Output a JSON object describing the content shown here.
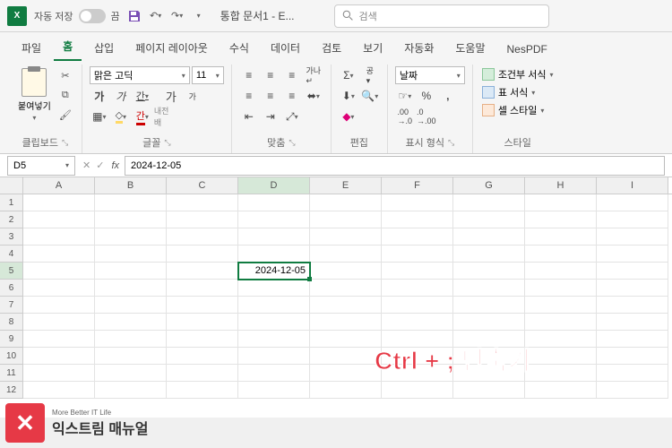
{
  "titlebar": {
    "autosave_label": "자동 저장",
    "autosave_state": "끔",
    "doc_title": "통합 문서1 - E..."
  },
  "search": {
    "placeholder": "검색"
  },
  "tabs": [
    "파일",
    "홈",
    "삽입",
    "페이지 레이아웃",
    "수식",
    "데이터",
    "검토",
    "보기",
    "자동화",
    "도움말",
    "NesPDF"
  ],
  "active_tab_index": 1,
  "ribbon": {
    "clipboard": {
      "label": "클립보드",
      "paste": "붙여넣기"
    },
    "font": {
      "label": "글꼴",
      "name": "맑은 고딕",
      "size": "11",
      "bold": "가",
      "italic": "가",
      "underline": "간",
      "grow": "가",
      "shrink": "가",
      "hanja": "내전 배"
    },
    "align": {
      "label": "맞춤"
    },
    "edit": {
      "label": "편집"
    },
    "number": {
      "label": "표시 형식",
      "format": "날짜"
    },
    "styles": {
      "label": "스타일",
      "cond": "조건부 서식",
      "table": "표 서식",
      "cell": "셀 스타일"
    }
  },
  "namebox": {
    "ref": "D5"
  },
  "formula": {
    "value": "2024-12-05"
  },
  "grid": {
    "cols": [
      "A",
      "B",
      "C",
      "D",
      "E",
      "F",
      "G",
      "H",
      "I"
    ],
    "rows": [
      "1",
      "2",
      "3",
      "4",
      "5",
      "6",
      "7",
      "8",
      "9",
      "10",
      "11",
      "12"
    ],
    "selected_col_index": 3,
    "selected_row_index": 4,
    "cell_value": "2024-12-05"
  },
  "overlay": {
    "text": "Ctrl + ; 단축키"
  },
  "watermark": {
    "sub": "More Better IT Life",
    "main": "익스트림 매뉴얼"
  }
}
